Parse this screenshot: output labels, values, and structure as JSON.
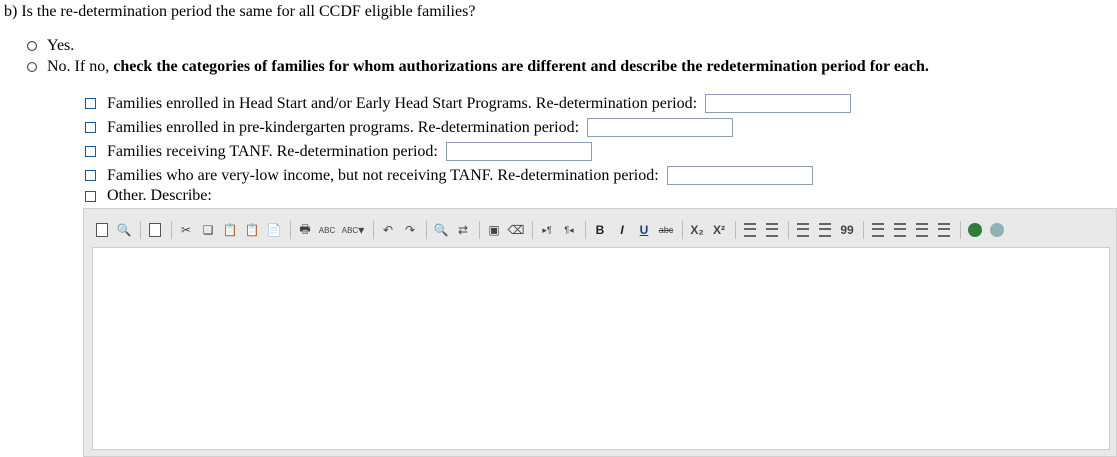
{
  "question": {
    "text": "b) Is the re-determination period the same for all CCDF eligible families?"
  },
  "options": {
    "yes": {
      "label": "Yes."
    },
    "no": {
      "label": "No. If no,",
      "emphasis": "check the categories of families for whom authorizations are different and describe the redetermination period for each."
    }
  },
  "categories": [
    {
      "label": "Families enrolled in Head Start and/or Early Head Start Programs. Re-determination period:",
      "value": ""
    },
    {
      "label": "Families enrolled in pre-kindergarten programs. Re-determination period:",
      "value": ""
    },
    {
      "label": "Families receiving TANF. Re-determination period:",
      "value": ""
    },
    {
      "label": "Families who are very-low income, but not receiving TANF. Re-determination period:",
      "value": ""
    },
    {
      "label": "Other. Describe:"
    }
  ],
  "toolbar": {
    "spell_label": "ABC",
    "spell_dropdown_label": "ABC",
    "bold": "B",
    "italic": "I",
    "underline": "U",
    "strike": "abc",
    "subscript": "X₂",
    "superscript": "X²",
    "quote": "99"
  }
}
